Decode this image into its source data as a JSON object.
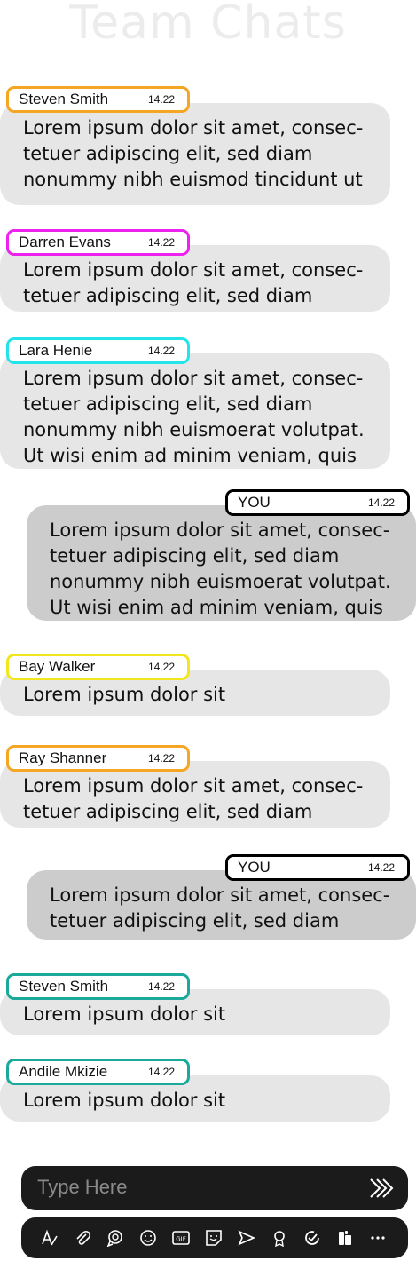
{
  "header": {
    "title": "Team Chats"
  },
  "messages": [
    {
      "sender": "Steven Smith",
      "time": "14.22",
      "text": "Lorem ipsum dolor sit amet, consec-\ntetuer adipiscing elit, sed diam\nnonummy nibh euismod tincidunt ut",
      "self": false,
      "color": "#f5a623"
    },
    {
      "sender": "Darren Evans",
      "time": "14.22",
      "text": "Lorem ipsum dolor sit amet, consec-\ntetuer adipiscing elit, sed diam",
      "self": false,
      "color": "#ee22ee"
    },
    {
      "sender": "Lara Henie",
      "time": "14.22",
      "text": "Lorem ipsum dolor sit amet, consec-\ntetuer adipiscing elit, sed diam\nnonummy nibh euismoerat volutpat.\nUt wisi enim ad minim veniam, quis",
      "self": false,
      "color": "#22e4ea"
    },
    {
      "sender": "YOU",
      "time": "14.22",
      "text": "Lorem ipsum dolor sit amet, consec-\ntetuer adipiscing elit, sed diam\nnonummy nibh euismoerat volutpat.\nUt wisi enim ad minim veniam, quis",
      "self": true,
      "color": "#000000"
    },
    {
      "sender": "Bay Walker",
      "time": "14.22",
      "text": "Lorem ipsum dolor sit",
      "self": false,
      "color": "#f2e61c"
    },
    {
      "sender": "Ray Shanner",
      "time": "14.22",
      "text": "Lorem ipsum dolor sit amet, consec-\ntetuer adipiscing elit, sed diam",
      "self": false,
      "color": "#f5a623"
    },
    {
      "sender": "YOU",
      "time": "14.22",
      "text": "Lorem ipsum dolor sit amet, consec-\ntetuer adipiscing elit, sed diam",
      "self": true,
      "color": "#000000"
    },
    {
      "sender": "Steven Smith",
      "time": "14.22",
      "text": "Lorem ipsum dolor sit",
      "self": false,
      "color": "#1aa99a"
    },
    {
      "sender": "Andile Mkizie",
      "time": "14.22",
      "text": "Lorem ipsum dolor sit",
      "self": false,
      "color": "#1aa99a"
    }
  ],
  "composer": {
    "placeholder": "Type Here",
    "send_icon": "send-chevrons-icon"
  },
  "toolbar": {
    "icons": [
      "format-text-icon",
      "attach-icon",
      "loop-icon",
      "emoji-icon",
      "gif-icon",
      "sticker-icon",
      "schedule-send-icon",
      "praise-icon",
      "approvals-icon",
      "apps-icon",
      "more-icon"
    ]
  }
}
